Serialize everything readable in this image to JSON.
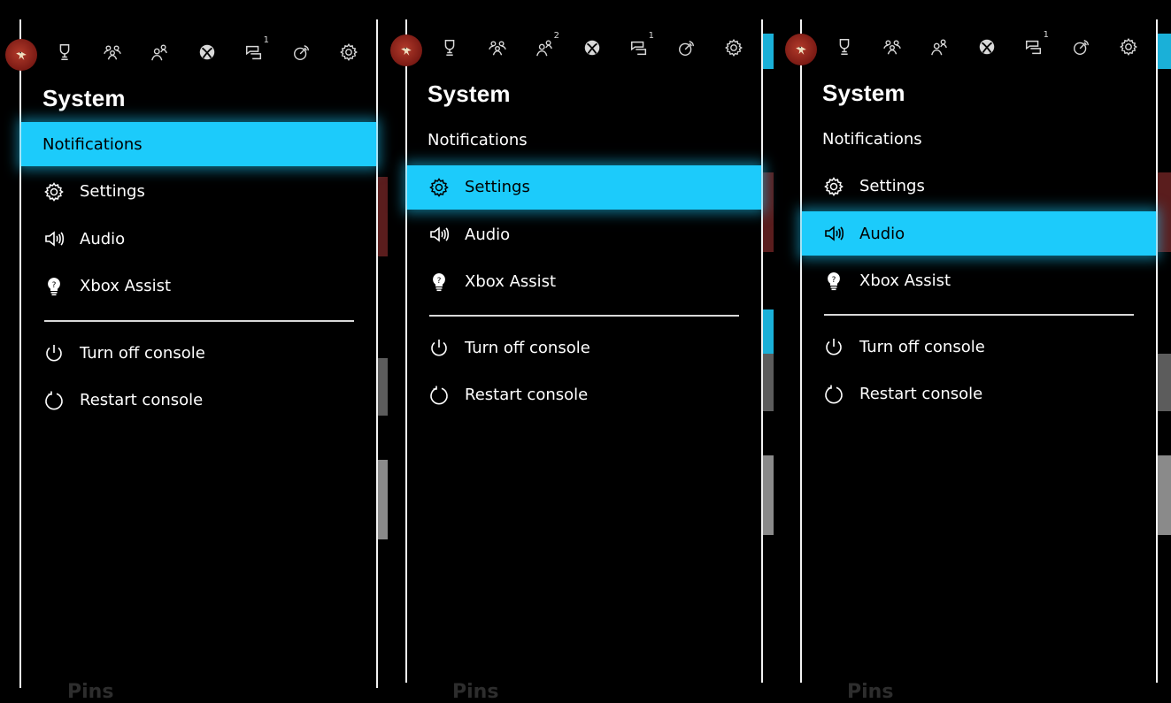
{
  "panels": [
    {
      "title": "System",
      "selected": "notifications",
      "tabs": [
        {
          "icon": "avatar-icon"
        },
        {
          "icon": "trophy-icon",
          "badge": ""
        },
        {
          "icon": "party-icon",
          "badge": ""
        },
        {
          "icon": "friends-icon",
          "badge": ""
        },
        {
          "icon": "xbox-icon",
          "badge": ""
        },
        {
          "icon": "messages-icon",
          "badge": "1"
        },
        {
          "icon": "broadcast-icon",
          "badge": ""
        },
        {
          "icon": "gear-icon",
          "badge": ""
        }
      ],
      "menu": [
        {
          "id": "notifications",
          "label": "Notifications",
          "icon": ""
        },
        {
          "id": "settings",
          "label": "Settings",
          "icon": "gear-icon"
        },
        {
          "id": "audio",
          "label": "Audio",
          "icon": "speaker-icon"
        },
        {
          "id": "xbox-assist",
          "label": "Xbox Assist",
          "icon": "lightbulb-icon"
        }
      ],
      "power": [
        {
          "id": "turn-off",
          "label": "Turn off console",
          "icon": "power-icon"
        },
        {
          "id": "restart",
          "label": "Restart console",
          "icon": "restart-icon"
        }
      ],
      "background_label": "Pins"
    },
    {
      "title": "System",
      "selected": "settings",
      "tabs": [
        {
          "icon": "avatar-icon"
        },
        {
          "icon": "trophy-icon",
          "badge": ""
        },
        {
          "icon": "party-icon",
          "badge": ""
        },
        {
          "icon": "friends-icon",
          "badge": "2"
        },
        {
          "icon": "xbox-icon",
          "badge": ""
        },
        {
          "icon": "messages-icon",
          "badge": "1"
        },
        {
          "icon": "broadcast-icon",
          "badge": ""
        },
        {
          "icon": "gear-icon",
          "badge": ""
        }
      ],
      "menu": [
        {
          "id": "notifications",
          "label": "Notifications",
          "icon": ""
        },
        {
          "id": "settings",
          "label": "Settings",
          "icon": "gear-icon"
        },
        {
          "id": "audio",
          "label": "Audio",
          "icon": "speaker-icon"
        },
        {
          "id": "xbox-assist",
          "label": "Xbox Assist",
          "icon": "lightbulb-icon"
        }
      ],
      "power": [
        {
          "id": "turn-off",
          "label": "Turn off console",
          "icon": "power-icon"
        },
        {
          "id": "restart",
          "label": "Restart console",
          "icon": "restart-icon"
        }
      ],
      "background_label": "Pins"
    },
    {
      "title": "System",
      "selected": "audio",
      "tabs": [
        {
          "icon": "avatar-icon"
        },
        {
          "icon": "trophy-icon",
          "badge": ""
        },
        {
          "icon": "party-icon",
          "badge": ""
        },
        {
          "icon": "friends-icon",
          "badge": ""
        },
        {
          "icon": "xbox-icon",
          "badge": ""
        },
        {
          "icon": "messages-icon",
          "badge": "1"
        },
        {
          "icon": "broadcast-icon",
          "badge": ""
        },
        {
          "icon": "gear-icon",
          "badge": ""
        }
      ],
      "menu": [
        {
          "id": "notifications",
          "label": "Notifications",
          "icon": ""
        },
        {
          "id": "settings",
          "label": "Settings",
          "icon": "gear-icon"
        },
        {
          "id": "audio",
          "label": "Audio",
          "icon": "speaker-icon"
        },
        {
          "id": "xbox-assist",
          "label": "Xbox Assist",
          "icon": "lightbulb-icon"
        }
      ],
      "power": [
        {
          "id": "turn-off",
          "label": "Turn off console",
          "icon": "power-icon"
        },
        {
          "id": "restart",
          "label": "Restart console",
          "icon": "restart-icon"
        }
      ],
      "background_label": "Pins"
    }
  ],
  "colors": {
    "highlight": "#1ccbfb",
    "background": "#000000",
    "text": "#ffffff",
    "icon": "#d9d9d9",
    "avatar": "#8b1e16"
  }
}
